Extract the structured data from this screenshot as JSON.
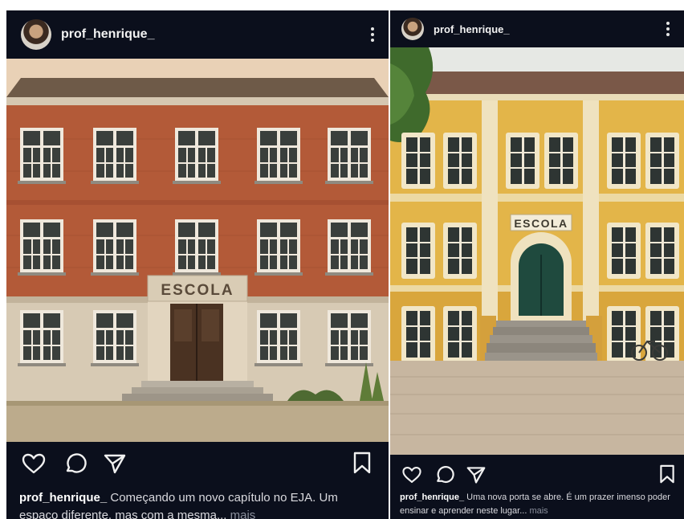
{
  "posts": [
    {
      "username": "prof_henrique_",
      "sign_text": "ESCOLA",
      "caption_user": "prof_henrique_",
      "caption_text": "Começando um novo capítulo no EJA. Um espaço diferente, mas com a mesma...",
      "caption_more": "mais",
      "icons": [
        "heart-icon",
        "comment-icon",
        "share-icon",
        "bookmark-icon",
        "more-options-icon"
      ]
    },
    {
      "username": "prof_henrique_",
      "sign_text": "ESCOLA",
      "caption_user": "prof_henrique_",
      "caption_text": "Uma nova porta se abre. É um prazer imenso poder ensinar e aprender neste lugar...",
      "caption_more": "mais",
      "icons": [
        "heart-icon",
        "comment-icon",
        "share-icon",
        "bookmark-icon",
        "more-options-icon"
      ]
    }
  ],
  "colors": {
    "post_background": "#0b0f1c",
    "brick": "#b35a38",
    "yellow_facade": "#e3b549"
  }
}
